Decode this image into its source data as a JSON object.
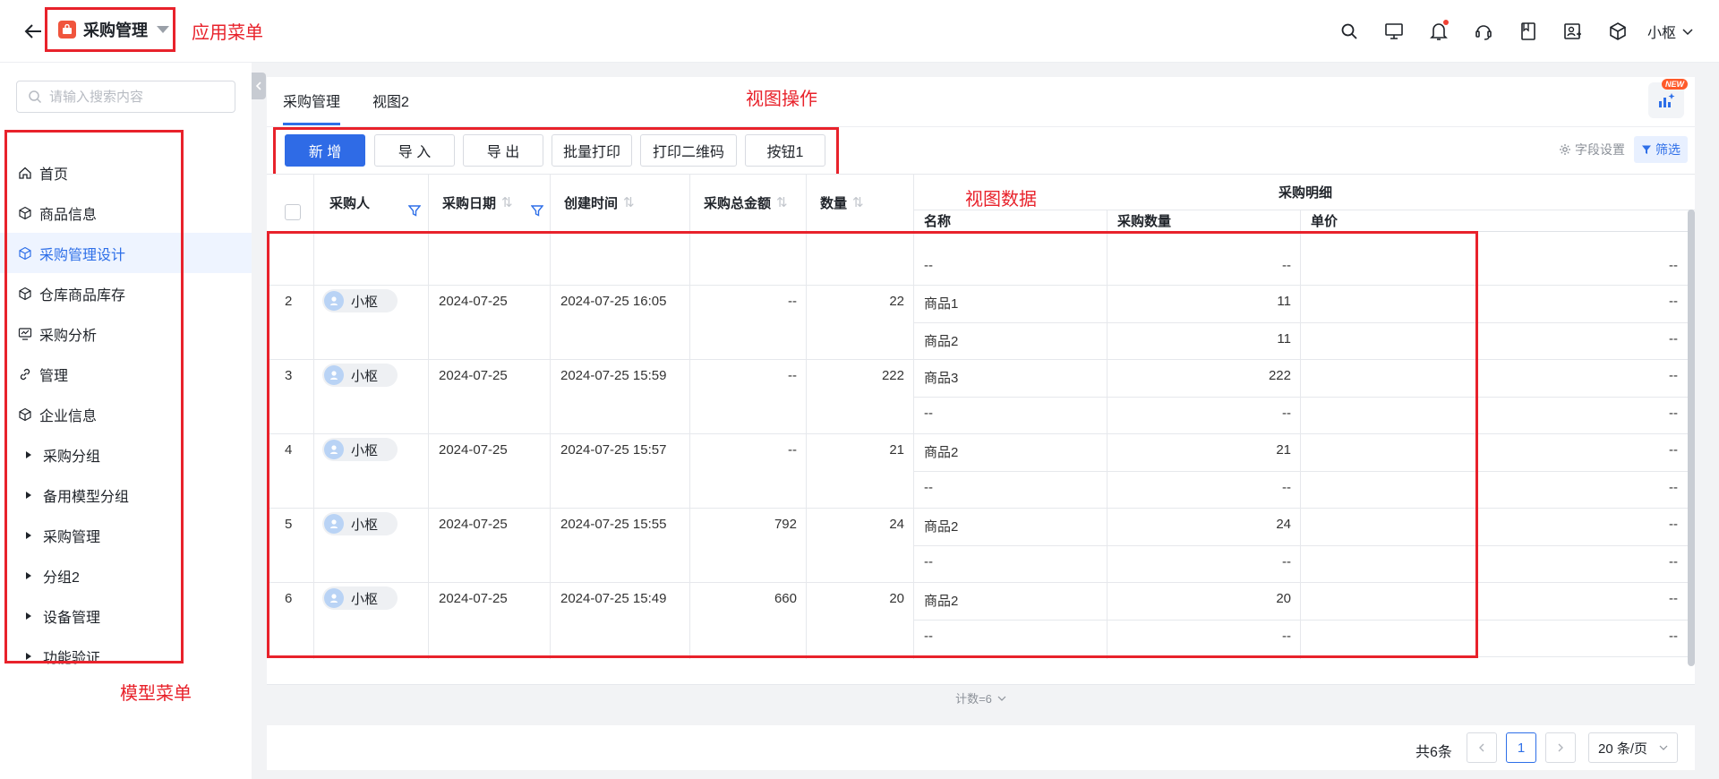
{
  "app": {
    "title": "采购管理"
  },
  "annotations": {
    "app_menu": "应用菜单",
    "view_ops": "视图操作",
    "view_data": "视图数据",
    "model_menu": "模型菜单"
  },
  "topbar": {
    "icons": [
      "search-icon",
      "monitor-icon",
      "bell-icon",
      "headset-icon",
      "bookmark-icon",
      "user-card-icon",
      "cube-icon"
    ],
    "user": "小枢"
  },
  "sidebar": {
    "search_placeholder": "请输入搜索内容",
    "items": [
      {
        "label": "首页",
        "icon": "home-icon"
      },
      {
        "label": "商品信息",
        "icon": "cube-icon"
      },
      {
        "label": "采购管理设计",
        "icon": "cube-icon",
        "active": true
      },
      {
        "label": "仓库商品库存",
        "icon": "cube-icon"
      },
      {
        "label": "采购分析",
        "icon": "chart-monitor-icon"
      },
      {
        "label": "管理",
        "icon": "link-icon"
      },
      {
        "label": "企业信息",
        "icon": "cube-icon"
      }
    ],
    "groups": [
      "采购分组",
      "备用模型分组",
      "采购管理",
      "分组2",
      "设备管理",
      "功能验证"
    ]
  },
  "tabs": [
    "采购管理",
    "视图2"
  ],
  "new_badge": "NEW",
  "toolbar": {
    "buttons": [
      "新 增",
      "导 入",
      "导 出",
      "批量打印",
      "打印二维码",
      "按钮1"
    ],
    "field_settings": "字段设置",
    "filter": "筛选"
  },
  "table": {
    "headers": {
      "buyer": "采购人",
      "date": "采购日期",
      "created": "创建时间",
      "total": "采购总金额",
      "qty": "数量",
      "detail_group": "采购明细",
      "name": "名称",
      "detail_qty": "采购数量",
      "price": "单价"
    },
    "first_row": {
      "name": "--",
      "detail_qty": "--",
      "price": "--"
    },
    "rows": [
      {
        "idx": "2",
        "buyer": "小枢",
        "date": "2024-07-25",
        "created": "2024-07-25 16:05",
        "total": "--",
        "qty": "22",
        "details": [
          {
            "name": "商品1",
            "qty": "11",
            "price": "--"
          },
          {
            "name": "商品2",
            "qty": "11",
            "price": "--"
          }
        ]
      },
      {
        "idx": "3",
        "buyer": "小枢",
        "date": "2024-07-25",
        "created": "2024-07-25 15:59",
        "total": "--",
        "qty": "222",
        "details": [
          {
            "name": "商品3",
            "qty": "222",
            "price": "--"
          },
          {
            "name": "--",
            "qty": "--",
            "price": "--"
          }
        ]
      },
      {
        "idx": "4",
        "buyer": "小枢",
        "date": "2024-07-25",
        "created": "2024-07-25 15:57",
        "total": "--",
        "qty": "21",
        "details": [
          {
            "name": "商品2",
            "qty": "21",
            "price": "--"
          },
          {
            "name": "--",
            "qty": "--",
            "price": "--"
          }
        ]
      },
      {
        "idx": "5",
        "buyer": "小枢",
        "date": "2024-07-25",
        "created": "2024-07-25 15:55",
        "total": "792",
        "qty": "24",
        "details": [
          {
            "name": "商品2",
            "qty": "24",
            "price": "--"
          },
          {
            "name": "--",
            "qty": "--",
            "price": "--"
          }
        ]
      },
      {
        "idx": "6",
        "buyer": "小枢",
        "date": "2024-07-25",
        "created": "2024-07-25 15:49",
        "total": "660",
        "qty": "20",
        "details": [
          {
            "name": "商品2",
            "qty": "20",
            "price": "--"
          },
          {
            "name": "--",
            "qty": "--",
            "price": "--"
          }
        ]
      }
    ],
    "count_label": "计数=6"
  },
  "pagination": {
    "total": "共6条",
    "current": "1",
    "page_size": "20 条/页"
  },
  "colors": {
    "accent": "#2f6be6",
    "annotation": "#e8222b",
    "highlight_row": "#f5a623"
  }
}
